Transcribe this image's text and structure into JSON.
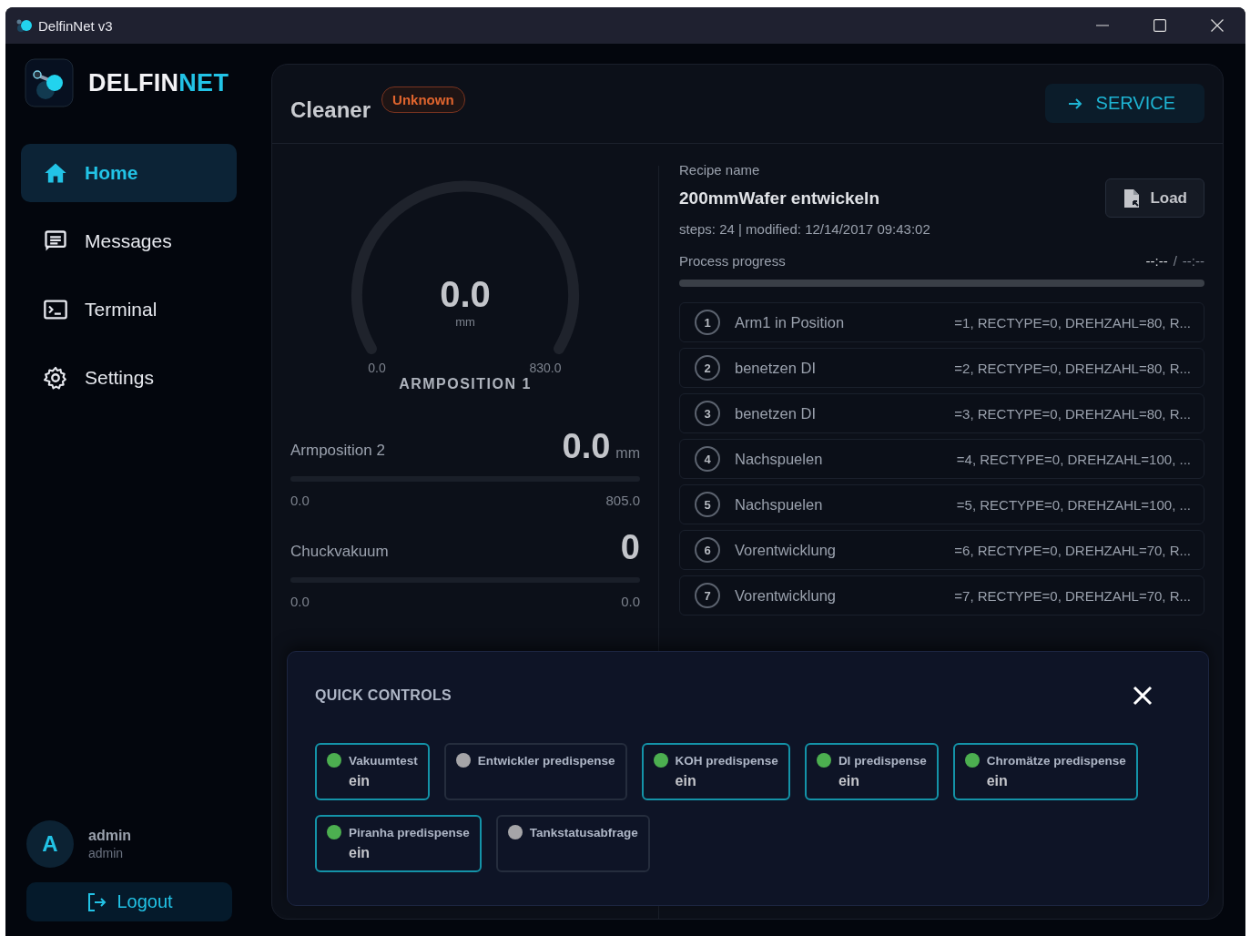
{
  "window": {
    "title": "DelfinNet v3"
  },
  "brand": {
    "name_part_1": "DELFIN",
    "name_part_2": "NET"
  },
  "nav": [
    {
      "label": "Home",
      "selected": true
    },
    {
      "label": "Messages",
      "selected": false
    },
    {
      "label": "Terminal",
      "selected": false
    },
    {
      "label": "Settings",
      "selected": false
    }
  ],
  "user": {
    "initial": "A",
    "name": "admin",
    "role": "admin"
  },
  "logout": "Logout",
  "header": {
    "title": "Cleaner",
    "status": "Unknown",
    "service": "SERVICE"
  },
  "gauge": {
    "value": "0.0",
    "unit": "mm",
    "min": "0.0",
    "max": "830.0",
    "label": "ARMPOSITION 1"
  },
  "metrics": [
    {
      "label": "Armposition 2",
      "value": "0.0",
      "unit": "mm",
      "min": "0.0",
      "max": "805.0",
      "level": 0
    },
    {
      "label": "Chuckvakuum",
      "value": "0",
      "min": "0.0",
      "max": "0.0",
      "level": 0
    }
  ],
  "recipe": {
    "label": "Recipe name",
    "name": "200mmWafer entwickeln",
    "meta": "steps: 24 | modified: 12/14/2017 09:43:02",
    "load": "Load"
  },
  "progress": {
    "label": "Process progress",
    "elapsed": "--:--",
    "separator": "/",
    "total": "--:--",
    "level": 0
  },
  "steps": [
    {
      "number": "1",
      "name": "Arm1 in Position",
      "params": "=1, RECTYPE=0, DREHZAHL=80, R..."
    },
    {
      "number": "2",
      "name": "benetzen DI",
      "params": "=2, RECTYPE=0, DREHZAHL=80, R..."
    },
    {
      "number": "3",
      "name": "benetzen DI",
      "params": "=3, RECTYPE=0, DREHZAHL=80, R..."
    },
    {
      "number": "4",
      "name": "Nachspuelen",
      "params": "=4, RECTYPE=0, DREHZAHL=100, ..."
    },
    {
      "number": "5",
      "name": "Nachspuelen",
      "params": "=5, RECTYPE=0, DREHZAHL=100, ..."
    },
    {
      "number": "6",
      "name": "Vorentwicklung",
      "params": "=6, RECTYPE=0, DREHZAHL=70, R..."
    },
    {
      "number": "7",
      "name": "Vorentwicklung",
      "params": "=7, RECTYPE=0, DREHZAHL=70, R..."
    }
  ],
  "quick_controls": {
    "title": "QUICK CONTROLS",
    "items": [
      {
        "label": "Vakuumtest",
        "on": true,
        "value": "ein"
      },
      {
        "label": "Entwickler predispense",
        "on": false
      },
      {
        "label": "KOH predispense",
        "on": true,
        "value": "ein"
      },
      {
        "label": "DI predispense",
        "on": true,
        "value": "ein"
      },
      {
        "label": "Chromätze predispense",
        "on": true,
        "value": "ein"
      },
      {
        "label": "Piranha predispense",
        "on": true,
        "value": "ein"
      },
      {
        "label": "Tankstatusabfrage",
        "on": false
      }
    ]
  }
}
